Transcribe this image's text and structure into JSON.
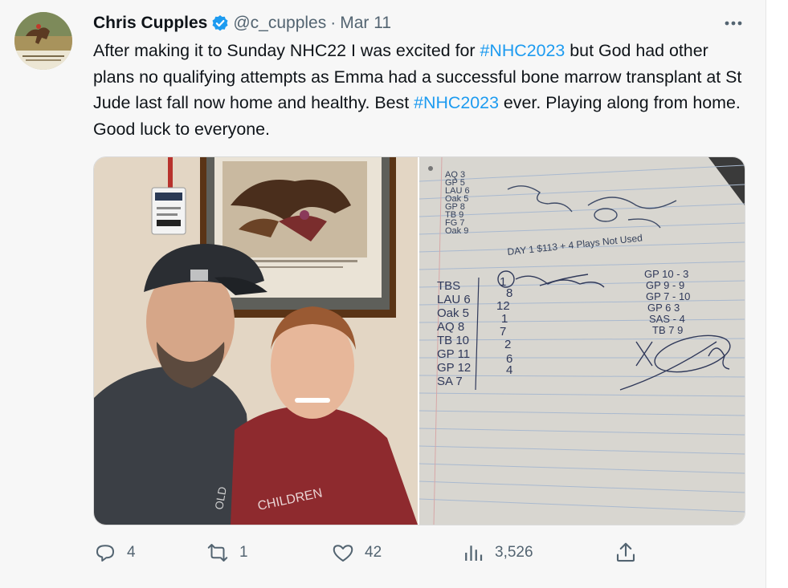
{
  "tweet": {
    "author": {
      "display_name": "Chris Cupples",
      "handle": "@c_cupples",
      "separator": "·",
      "date": "Mar 11",
      "avatar": "horse-racing-photo"
    },
    "more_icon": "more-dots-icon",
    "text": {
      "p1": "After making it to Sunday NHC22 I was excited for ",
      "tag1": "#NHC2023",
      "p2": " but God had other plans  no qualifying attempts as Emma had a successful bone marrow transplant at St Jude last fall now home and healthy.  Best ",
      "tag2": "#NHC2023",
      "p3": " ever.  Playing along from home.  Good luck to everyone."
    },
    "media": [
      {
        "description_id": "selfie-photo",
        "icon": "photo"
      },
      {
        "description_id": "handwritten-notes-photo",
        "icon": "photo"
      }
    ],
    "actions": {
      "reply": {
        "icon": "reply-icon",
        "count": "4"
      },
      "retweet": {
        "icon": "retweet-icon",
        "count": "1"
      },
      "like": {
        "icon": "like-icon",
        "count": "42"
      },
      "views": {
        "icon": "views-icon",
        "count": "3,526"
      },
      "share": {
        "icon": "share-icon"
      }
    },
    "colors": {
      "accent": "#1d9bf0",
      "text": "#0f1419",
      "muted": "#536471",
      "background": "#f7f7f7"
    }
  },
  "notes_photo": {
    "left_column": [
      "TBS",
      "LAU 6",
      "Oak 5",
      "AQ 8",
      "TB 10",
      "GP 11",
      "GP 12",
      "SA 7"
    ],
    "left_numbers": [
      "1",
      "8",
      "12",
      "1",
      "7",
      "2",
      "6",
      "4"
    ],
    "right_column": [
      "GP 10 - 3",
      "GP 9 - 9",
      "GP 7 - 10",
      "GP 6  3",
      "SAS - 4",
      "TB 7  9"
    ],
    "mid_line": "DAY 1   $113 + 4 Plays  Not Used",
    "top_list": [
      "AQ 3",
      "GP 5",
      "LAU 6",
      "Oak 5",
      "GP 8",
      "TB 9",
      "FG 7",
      "Oak 9"
    ]
  }
}
